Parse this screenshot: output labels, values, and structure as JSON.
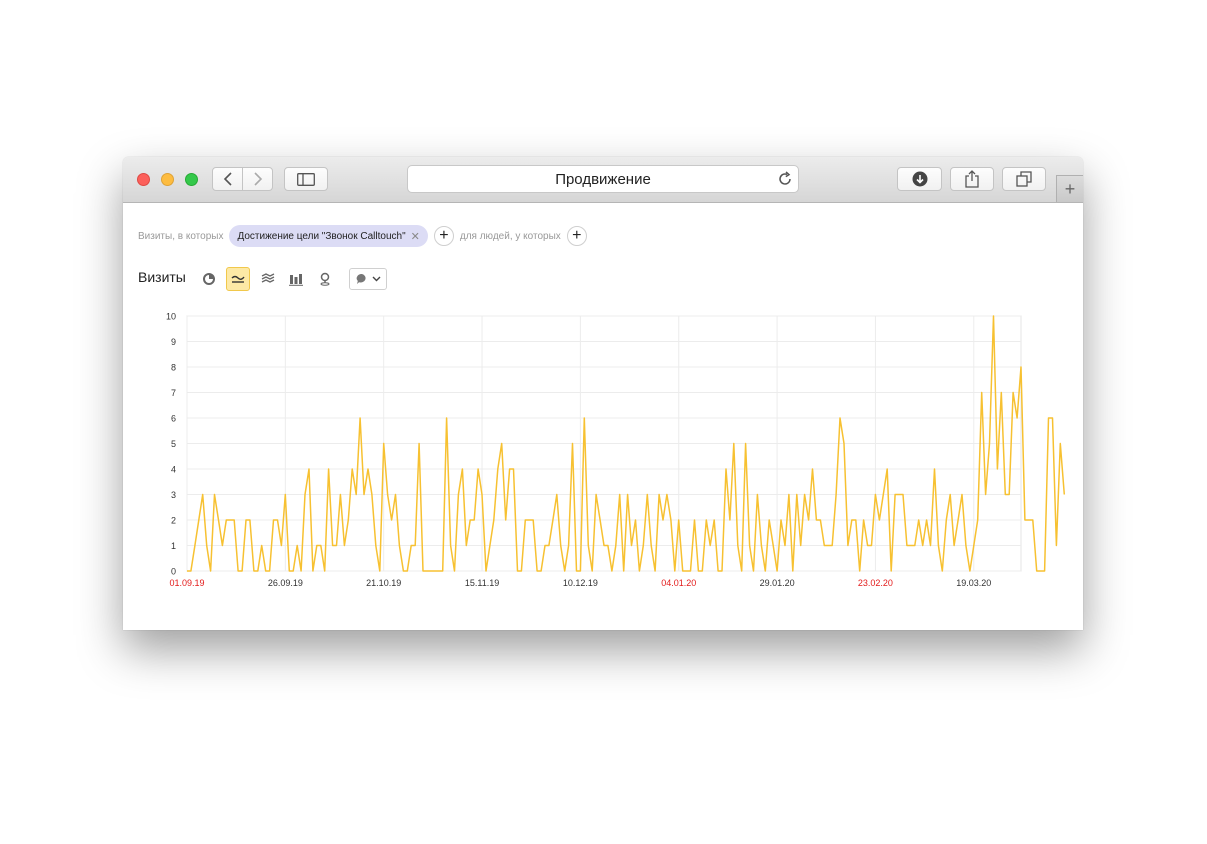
{
  "window": {
    "title": "Продвижение"
  },
  "segment": {
    "visits_prefix": "Визиты, в которых",
    "chip_label": "Достижение цели \"Звонок Calltouch\"",
    "people_prefix": "для людей, у которых"
  },
  "chart_title": "Визиты",
  "colors": {
    "line": "#f7c131",
    "weekend_label": "#e31c1c",
    "active_tab": "#fde9a6"
  },
  "icons": [
    "back-icon",
    "forward-icon",
    "sidebar-icon",
    "reload-icon",
    "download-icon",
    "share-icon",
    "tabs-icon",
    "plus-icon",
    "pie-chart-icon",
    "line-chart-icon",
    "area-stack-icon",
    "bar-chart-icon",
    "map-pin-icon",
    "comment-icon",
    "chevron-down-icon"
  ],
  "chart_data": {
    "type": "line",
    "title": "",
    "ylim": [
      0,
      10
    ],
    "y_ticks": [
      0,
      1,
      2,
      3,
      4,
      5,
      6,
      7,
      8,
      9,
      10
    ],
    "x_ticks": [
      {
        "label": "01.09.19",
        "index": 0,
        "weekend": true
      },
      {
        "label": "26.09.19",
        "index": 25,
        "weekend": false
      },
      {
        "label": "21.10.19",
        "index": 50,
        "weekend": false
      },
      {
        "label": "15.11.19",
        "index": 75,
        "weekend": false
      },
      {
        "label": "10.12.19",
        "index": 100,
        "weekend": false
      },
      {
        "label": "04.01.20",
        "index": 125,
        "weekend": true
      },
      {
        "label": "29.01.20",
        "index": 150,
        "weekend": false
      },
      {
        "label": "23.02.20",
        "index": 175,
        "weekend": true
      },
      {
        "label": "19.03.20",
        "index": 200,
        "weekend": false
      }
    ],
    "x_max_index": 212,
    "series": [
      {
        "values": [
          0,
          0,
          1,
          2,
          3,
          1,
          0,
          3,
          2,
          1,
          2,
          2,
          2,
          0,
          0,
          2,
          2,
          0,
          0,
          1,
          0,
          0,
          2,
          2,
          1,
          3,
          0,
          0,
          1,
          0,
          3,
          4,
          0,
          1,
          1,
          0,
          4,
          1,
          1,
          3,
          1,
          2,
          4,
          3,
          6,
          3,
          4,
          3,
          1,
          0,
          5,
          3,
          2,
          3,
          1,
          0,
          0,
          1,
          1,
          5,
          0,
          0,
          0,
          0,
          0,
          0,
          6,
          1,
          0,
          3,
          4,
          1,
          2,
          2,
          4,
          3,
          0,
          1,
          2,
          4,
          5,
          2,
          4,
          4,
          0,
          0,
          2,
          2,
          2,
          0,
          0,
          1,
          1,
          2,
          3,
          1,
          0,
          1,
          5,
          0,
          0,
          6,
          1,
          0,
          3,
          2,
          1,
          1,
          0,
          1,
          3,
          0,
          3,
          1,
          2,
          0,
          1,
          3,
          1,
          0,
          3,
          2,
          3,
          2,
          0,
          2,
          0,
          0,
          0,
          2,
          0,
          0,
          2,
          1,
          2,
          0,
          0,
          4,
          2,
          5,
          1,
          0,
          5,
          1,
          0,
          3,
          1,
          0,
          2,
          1,
          0,
          2,
          1,
          3,
          0,
          3,
          1,
          3,
          2,
          4,
          2,
          2,
          1,
          1,
          1,
          3,
          6,
          5,
          1,
          2,
          2,
          0,
          2,
          1,
          1,
          3,
          2,
          3,
          4,
          0,
          3,
          3,
          3,
          1,
          1,
          1,
          2,
          1,
          2,
          1,
          4,
          1,
          0,
          2,
          3,
          1,
          2,
          3,
          1,
          0,
          1,
          2,
          7,
          3,
          5,
          10,
          4,
          7,
          3,
          3,
          7,
          6,
          8,
          2,
          2,
          2,
          0,
          0,
          0,
          6,
          6,
          1,
          5,
          3
        ]
      }
    ]
  }
}
